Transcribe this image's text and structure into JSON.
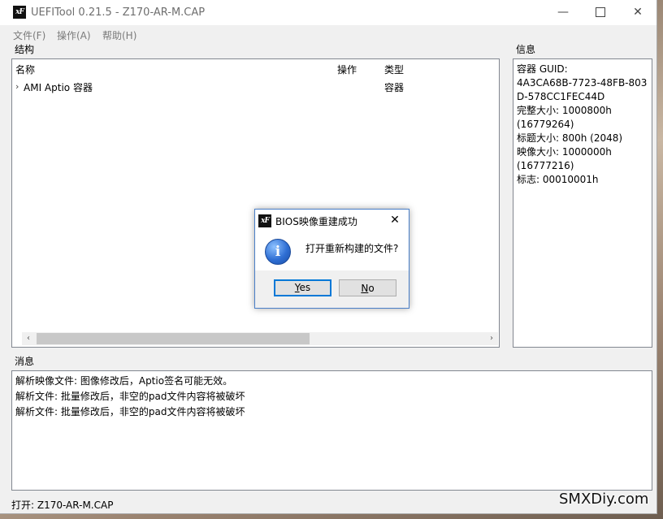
{
  "window": {
    "title": "UEFITool 0.21.5 - Z170-AR-M.CAP",
    "icon_glyph": "xF",
    "controls": {
      "minimize": "—",
      "close": "✕"
    }
  },
  "menu": {
    "items": [
      {
        "label": "文件(F)"
      },
      {
        "label": "操作(A)"
      },
      {
        "label": "帮助(H)"
      }
    ]
  },
  "structure": {
    "label": "结构",
    "columns": {
      "name": "名称",
      "action": "操作",
      "type": "类型"
    },
    "rows": [
      {
        "expander": "›",
        "name": "AMI Aptio 容器",
        "action": "",
        "type": "容器"
      }
    ],
    "scroll": {
      "left_arrow": "‹",
      "right_arrow": "›"
    }
  },
  "info": {
    "label": "信息",
    "text": "容器 GUID:\n4A3CA68B-7723-48FB-803D-578CC1FEC44D\n完整大小: 1000800h\n(16779264)\n标题大小: 800h (2048)\n映像大小: 1000000h\n(16777216)\n标志: 00010001h"
  },
  "messages": {
    "label": "消息",
    "lines": [
      "解析映像文件: 图像修改后，Aptio签名可能无效。",
      "解析文件: 批量修改后，非空的pad文件内容将被破坏",
      "解析文件: 批量修改后，非空的pad文件内容将被破坏"
    ]
  },
  "status": {
    "text": "打开: Z170-AR-M.CAP"
  },
  "watermark": "SMXDiy.com",
  "dialog": {
    "title": "BIOS映像重建成功",
    "close": "✕",
    "icon": "info-icon",
    "icon_glyph": "i",
    "message": "打开重新构建的文件?",
    "yes_label": "Yes",
    "no_label": "No"
  },
  "colors": {
    "accent": "#0078d7",
    "dialog_border": "#4a7fc8",
    "disabled_text": "#7a7a7a"
  }
}
